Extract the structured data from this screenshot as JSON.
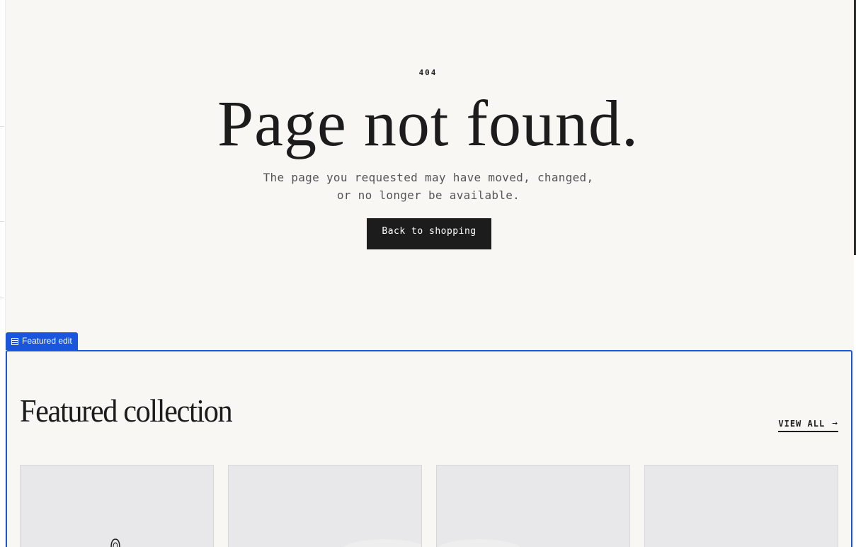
{
  "not_found": {
    "code": "404",
    "title": "Page not found.",
    "message": "The page you requested may have moved, changed, or no longer be available.",
    "button_label": "Back to shopping"
  },
  "editor": {
    "section_label": "Featured edit",
    "section_icon": "section-layout-icon",
    "accent_color": "#1a56db"
  },
  "featured": {
    "title": "Featured collection",
    "view_all_label": "VIEW ALL",
    "view_all_icon": "arrow-right-icon",
    "products": [
      {
        "image": "bag-placeholder"
      },
      {
        "image": "placeholder"
      },
      {
        "image": "placeholder"
      },
      {
        "image": "placeholder"
      }
    ]
  },
  "colors": {
    "background": "#f8f7f4",
    "text": "#1c1c1c",
    "button": "#1c1c1c",
    "card": "#e8e8ea"
  }
}
